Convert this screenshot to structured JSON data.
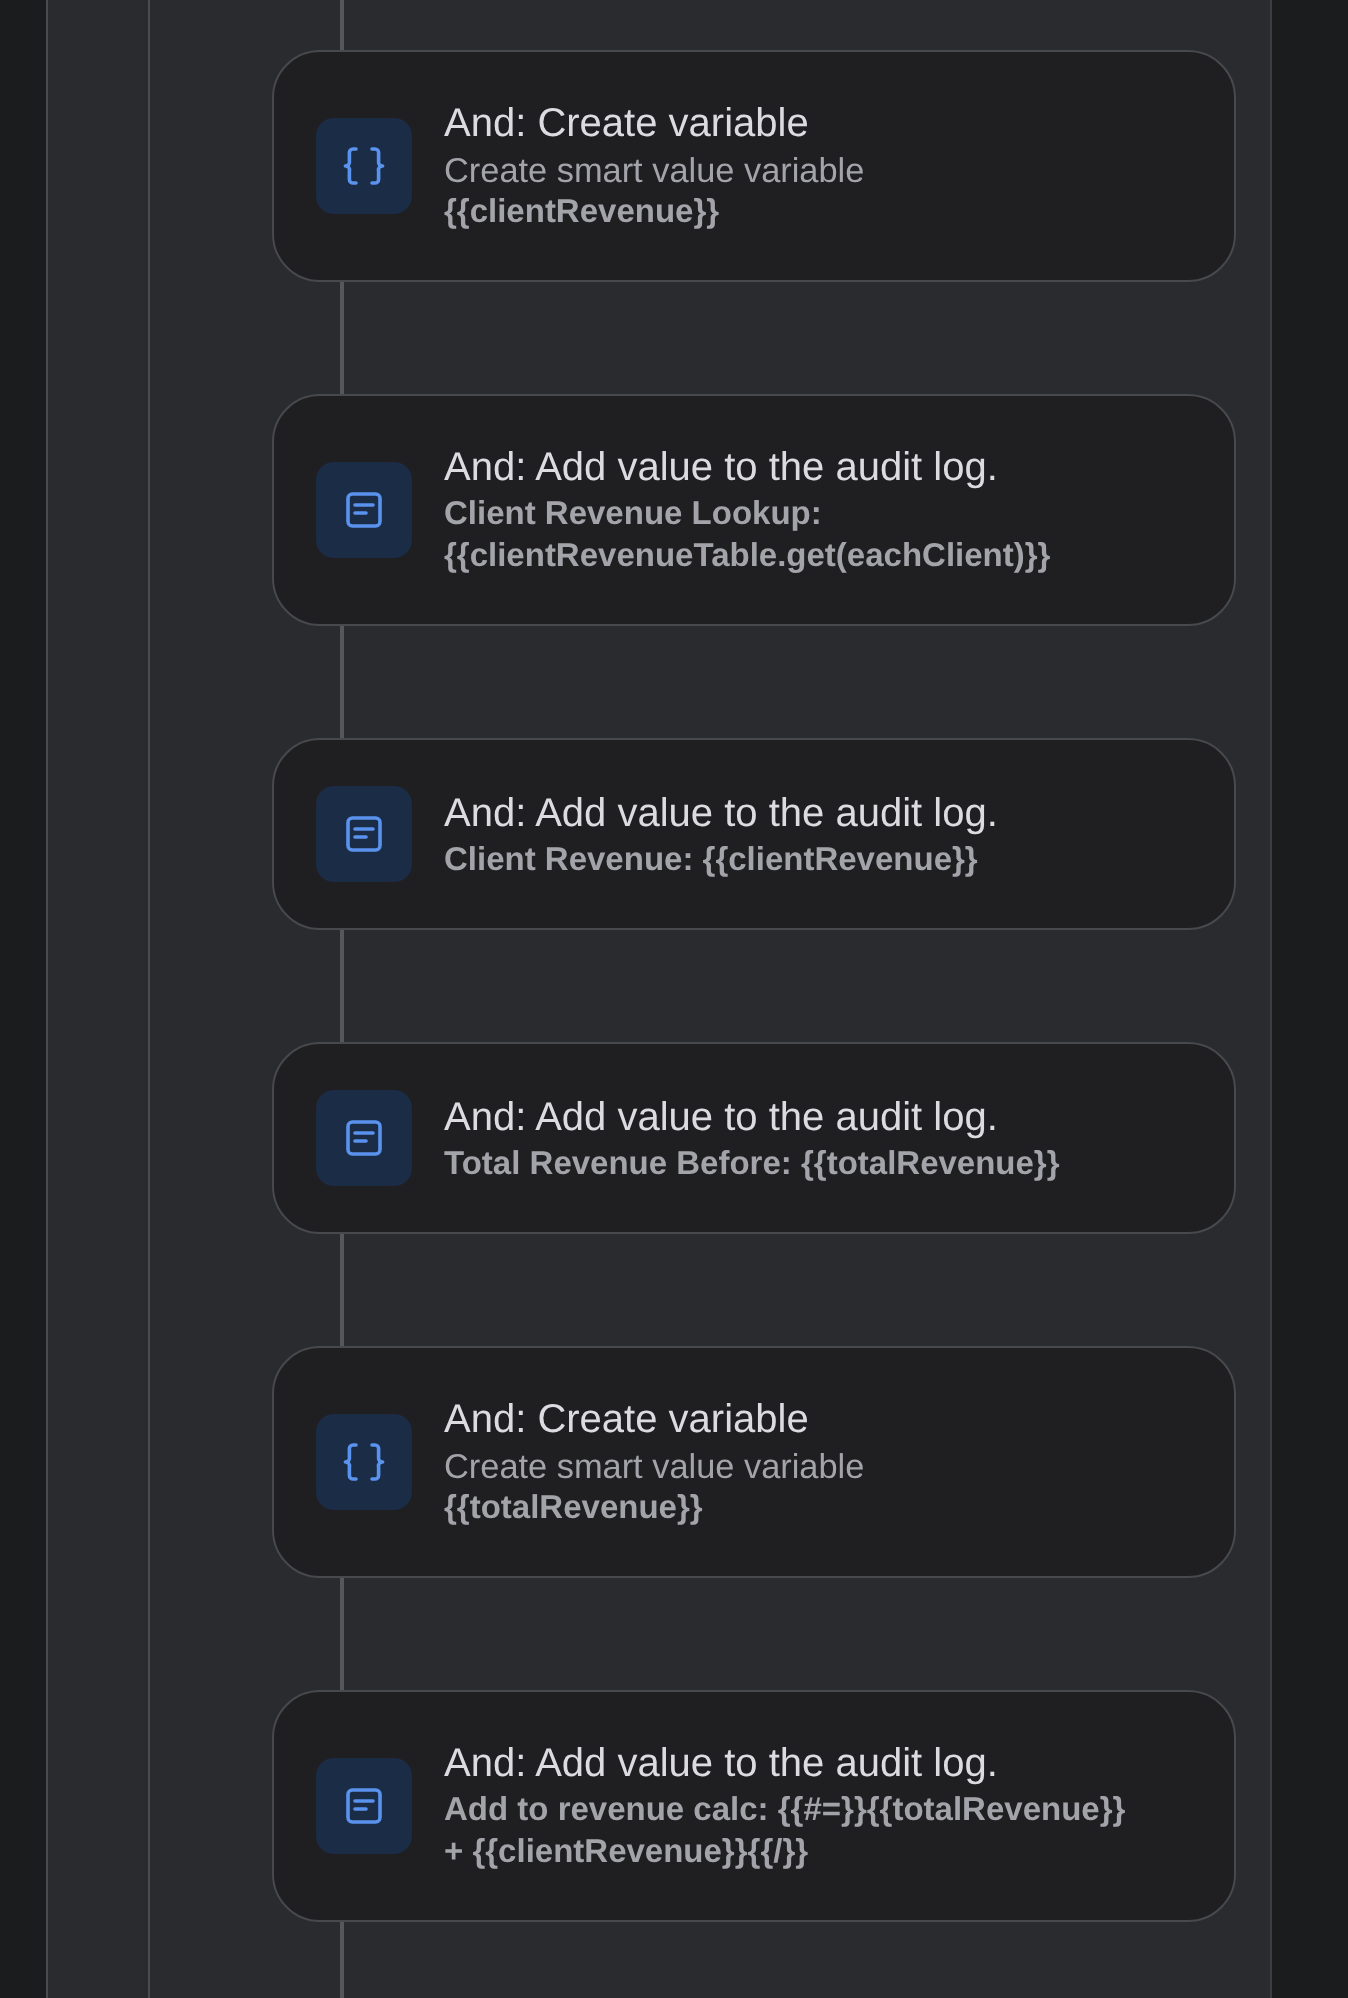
{
  "steps": [
    {
      "kind": "variable",
      "title": "And: Create variable",
      "description": "Create smart value variable",
      "value": "{{clientRevenue}}"
    },
    {
      "kind": "log",
      "title": "And: Add value to the audit log.",
      "message": "Client Revenue Lookup: {{clientRevenueTable.get(eachClient)}}"
    },
    {
      "kind": "log",
      "title": "And: Add value to the audit log.",
      "message": "Client Revenue: {{clientRevenue}}"
    },
    {
      "kind": "log",
      "title": "And: Add value to the audit log.",
      "message": "Total Revenue Before: {{totalRevenue}}"
    },
    {
      "kind": "variable",
      "title": "And: Create variable",
      "description": "Create smart value variable",
      "value": "{{totalRevenue}}"
    },
    {
      "kind": "log",
      "title": "And: Add value to the audit log.",
      "message": "Add to revenue calc: {{#=}}{{totalRevenue}} + {{clientRevenue}}{{/}}"
    }
  ]
}
